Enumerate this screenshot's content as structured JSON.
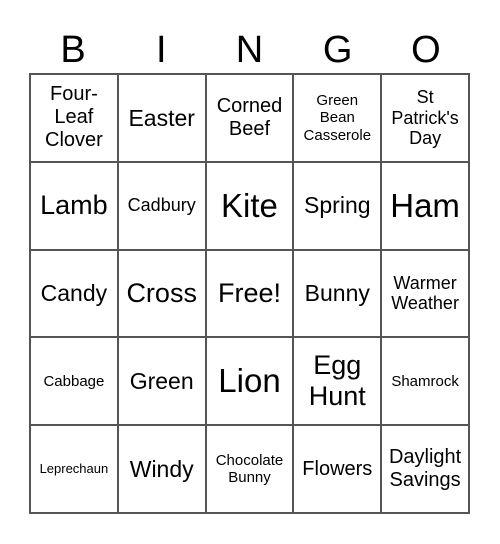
{
  "header": [
    "B",
    "I",
    "N",
    "G",
    "O"
  ],
  "cells": [
    {
      "text": "Four-\nLeaf\nClover",
      "size": "s-ms"
    },
    {
      "text": "Easter",
      "size": "s-m"
    },
    {
      "text": "Corned\nBeef",
      "size": "s-ms"
    },
    {
      "text": "Green\nBean\nCasserole",
      "size": "s-xxs"
    },
    {
      "text": "St\nPatrick's\nDay",
      "size": "s-s"
    },
    {
      "text": "Lamb",
      "size": "s-l"
    },
    {
      "text": "Cadbury",
      "size": "s-s"
    },
    {
      "text": "Kite",
      "size": "s-xl"
    },
    {
      "text": "Spring",
      "size": "s-m"
    },
    {
      "text": "Ham",
      "size": "s-xl"
    },
    {
      "text": "Candy",
      "size": "s-m"
    },
    {
      "text": "Cross",
      "size": "s-l"
    },
    {
      "text": "Free!",
      "size": "s-l"
    },
    {
      "text": "Bunny",
      "size": "s-m"
    },
    {
      "text": "Warmer\nWeather",
      "size": "s-s"
    },
    {
      "text": "Cabbage",
      "size": "s-xxs"
    },
    {
      "text": "Green",
      "size": "s-m"
    },
    {
      "text": "Lion",
      "size": "s-xl"
    },
    {
      "text": "Egg\nHunt",
      "size": "s-l"
    },
    {
      "text": "Shamrock",
      "size": "s-xxs"
    },
    {
      "text": "Leprechaun",
      "size": "s-tiny"
    },
    {
      "text": "Windy",
      "size": "s-m"
    },
    {
      "text": "Chocolate\nBunny",
      "size": "s-xxs"
    },
    {
      "text": "Flowers",
      "size": "s-ms"
    },
    {
      "text": "Daylight\nSavings",
      "size": "s-ms"
    }
  ]
}
